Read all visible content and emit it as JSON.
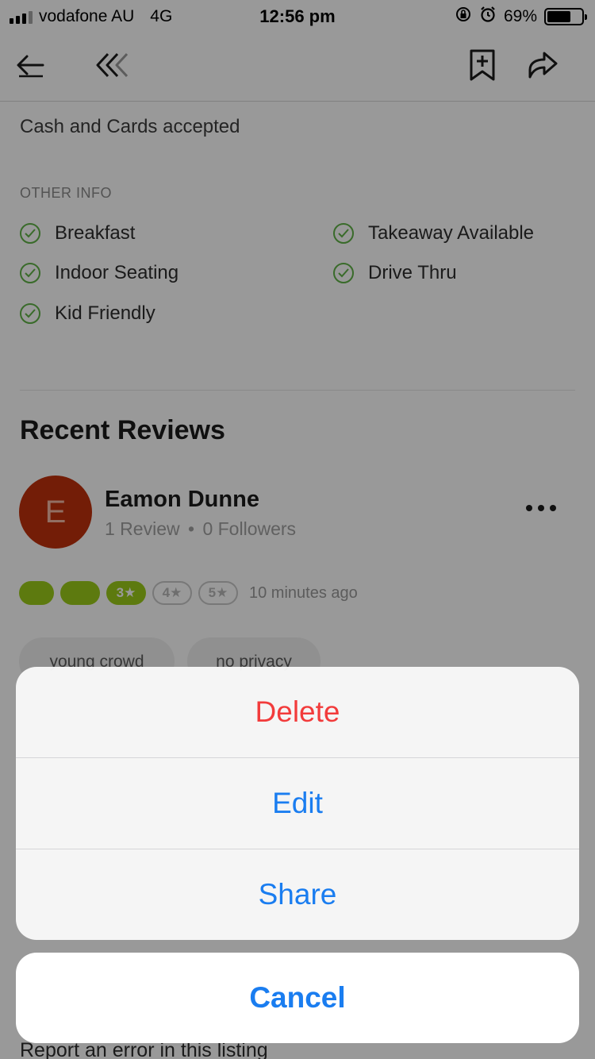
{
  "status_bar": {
    "carrier": "vodafone AU",
    "network": "4G",
    "time": "12:56 pm",
    "battery_percent": "69%",
    "battery_level": 0.69
  },
  "nav": {
    "icons": [
      "back-arrow-icon",
      "collapse-chevrons-icon",
      "bookmark-add-icon",
      "share-icon"
    ]
  },
  "restaurant": {
    "payment_text": "Cash and Cards accepted",
    "other_info_heading": "OTHER INFO",
    "features": [
      "Breakfast",
      "Takeaway Available",
      "Indoor Seating",
      "Drive Thru",
      "Kid Friendly"
    ]
  },
  "reviews": {
    "section_title": "Recent Reviews",
    "review": {
      "avatar_letter": "E",
      "avatar_color": "#c0310c",
      "name": "Eamon Dunne",
      "review_count": "1 Review",
      "separator": "•",
      "followers": "0 Followers",
      "rating_label": "3★",
      "rating_value": 3,
      "rating_options": [
        "4★",
        "5★"
      ],
      "time_ago": "10 minutes ago",
      "tags": [
        "young crowd",
        "no privacy"
      ]
    }
  },
  "footer": {
    "report_link": "Report an error in this listing"
  },
  "action_sheet": {
    "delete_label": "Delete",
    "edit_label": "Edit",
    "share_label": "Share",
    "cancel_label": "Cancel"
  },
  "colors": {
    "accent_blue": "#1a7df0",
    "destructive_red": "#f23b3b",
    "rating_green": "#9ccc1a",
    "check_green": "#60b246"
  }
}
